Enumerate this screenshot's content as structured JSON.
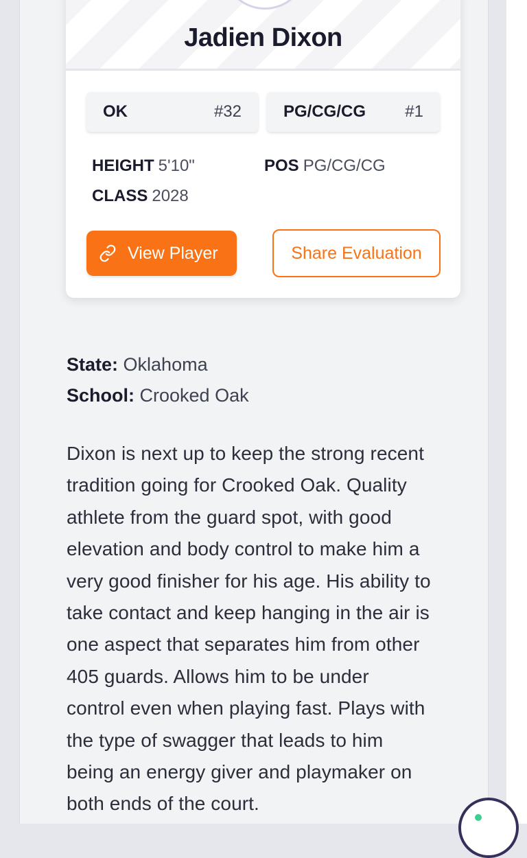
{
  "player": {
    "name": "Jadien Dixon"
  },
  "badges": [
    {
      "label": "OK",
      "value": "#32"
    },
    {
      "label": "PG/CG/CG",
      "value": "#1"
    }
  ],
  "stats": {
    "height_label": "HEIGHT",
    "height_value": "5'10\"",
    "class_label": "CLASS",
    "class_value": "2028",
    "pos_label": "POS",
    "pos_value": "PG/CG/CG"
  },
  "actions": {
    "view_player": "View Player",
    "share_evaluation": "Share Evaluation",
    "view_player_icon": "link-icon"
  },
  "details": {
    "state_label": "State:",
    "state_value": "Oklahoma",
    "school_label": "School:",
    "school_value": "Crooked Oak"
  },
  "bio_lines": [
    "Dixon is next up to keep the strong recent",
    "tradition going for Crooked Oak. Quality",
    "athlete from the guard spot, with good",
    "elevation and body control to make him a",
    "very good finisher for his age. His ability to",
    "take contact and keep hanging in the air is",
    "one aspect that separates him from other",
    "405 guards. Allows him to be under",
    "control even when playing fast. Plays with",
    "the type of swagger that leads to him",
    "being an energy giver and playmaker on",
    "both ends of the court."
  ],
  "colors": {
    "accent": "#f97316",
    "text_dark": "#1a1c2e",
    "page_bg": "#f2f3f5"
  },
  "widgets": {
    "cookie_icon": "cookie-icon"
  }
}
